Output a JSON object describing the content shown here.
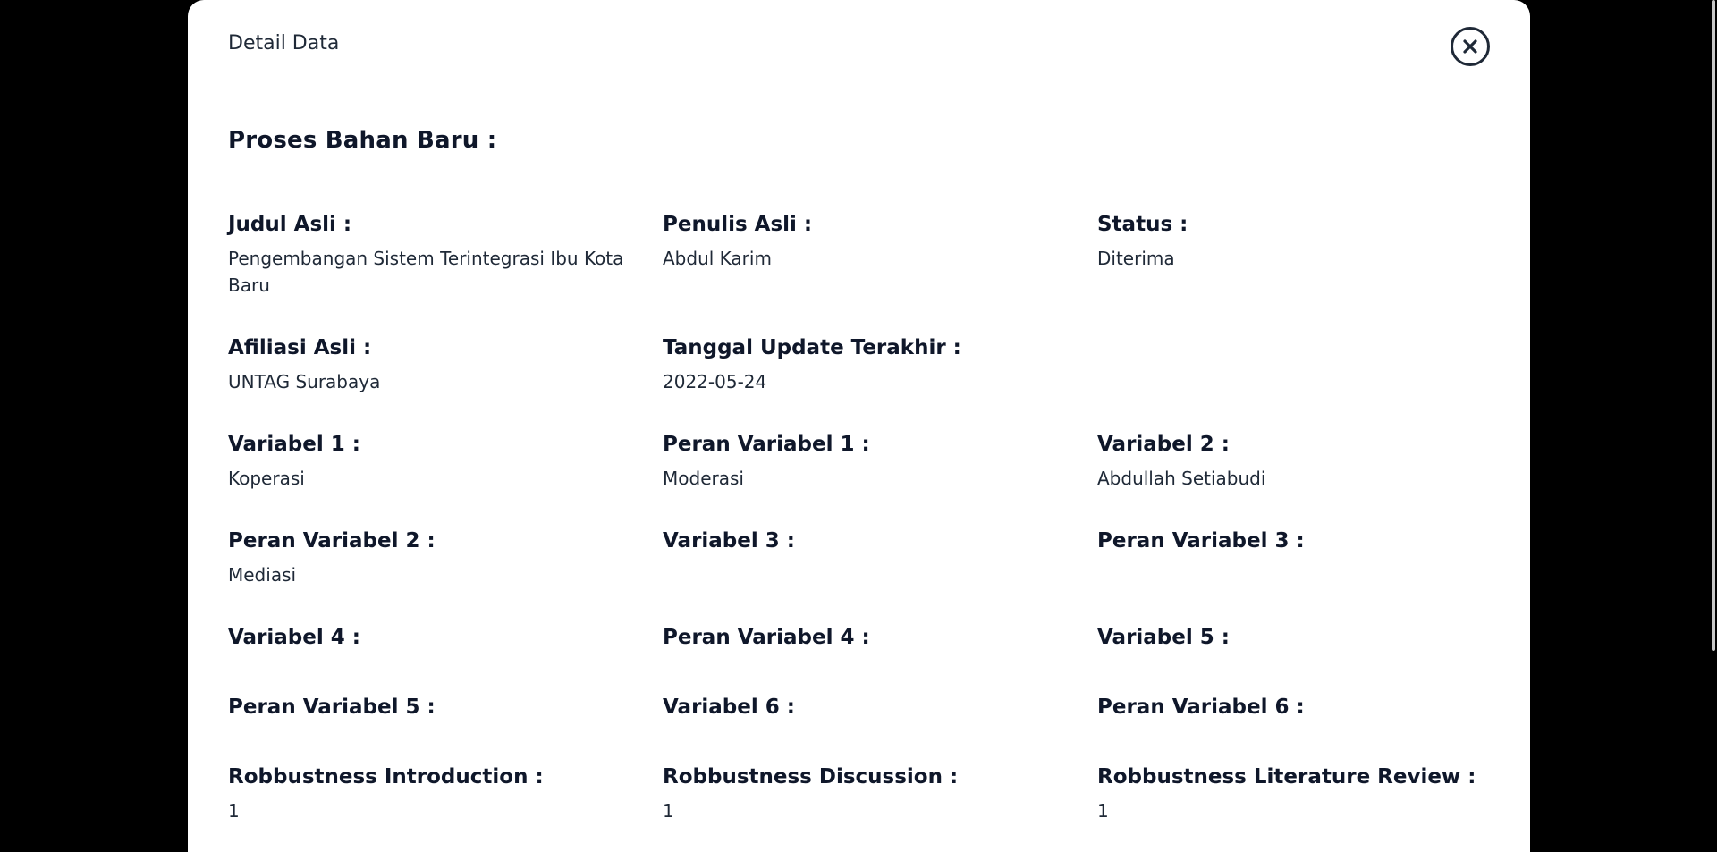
{
  "modal": {
    "title": "Detail Data",
    "section_title": "Proses Bahan Baru :"
  },
  "fields": {
    "judul_asli": {
      "label": "Judul Asli :",
      "value": "Pengembangan Sistem Terintegrasi Ibu Kota Baru"
    },
    "penulis_asli": {
      "label": "Penulis Asli :",
      "value": "Abdul Karim"
    },
    "status": {
      "label": "Status :",
      "value": "Diterima"
    },
    "afiliasi_asli": {
      "label": "Afiliasi Asli :",
      "value": "UNTAG Surabaya"
    },
    "tanggal_update": {
      "label": "Tanggal Update Terakhir :",
      "value": "2022-05-24"
    },
    "variabel_1": {
      "label": "Variabel 1 :",
      "value": "Koperasi"
    },
    "peran_variabel_1": {
      "label": "Peran Variabel 1 :",
      "value": "Moderasi"
    },
    "variabel_2": {
      "label": "Variabel 2 :",
      "value": "Abdullah Setiabudi"
    },
    "peran_variabel_2": {
      "label": "Peran Variabel 2 :",
      "value": "Mediasi"
    },
    "variabel_3": {
      "label": "Variabel 3 :",
      "value": ""
    },
    "peran_variabel_3": {
      "label": "Peran Variabel 3 :",
      "value": ""
    },
    "variabel_4": {
      "label": "Variabel 4 :",
      "value": ""
    },
    "peran_variabel_4": {
      "label": "Peran Variabel 4 :",
      "value": ""
    },
    "variabel_5": {
      "label": "Variabel 5 :",
      "value": ""
    },
    "peran_variabel_5": {
      "label": "Peran Variabel 5 :",
      "value": ""
    },
    "variabel_6": {
      "label": "Variabel 6 :",
      "value": ""
    },
    "peran_variabel_6": {
      "label": "Peran Variabel 6 :",
      "value": ""
    },
    "robbustness_introduction": {
      "label": "Robbustness Introduction :",
      "value": "1"
    },
    "robbustness_discussion": {
      "label": "Robbustness Discussion :",
      "value": "1"
    },
    "robbustness_literature_review": {
      "label": "Robbustness Literature Review :",
      "value": "1"
    }
  },
  "icons": {
    "close": "close-circle-icon"
  },
  "colors": {
    "backdrop": "#000000",
    "modal_bg": "#ffffff",
    "text": "#0f172a"
  }
}
